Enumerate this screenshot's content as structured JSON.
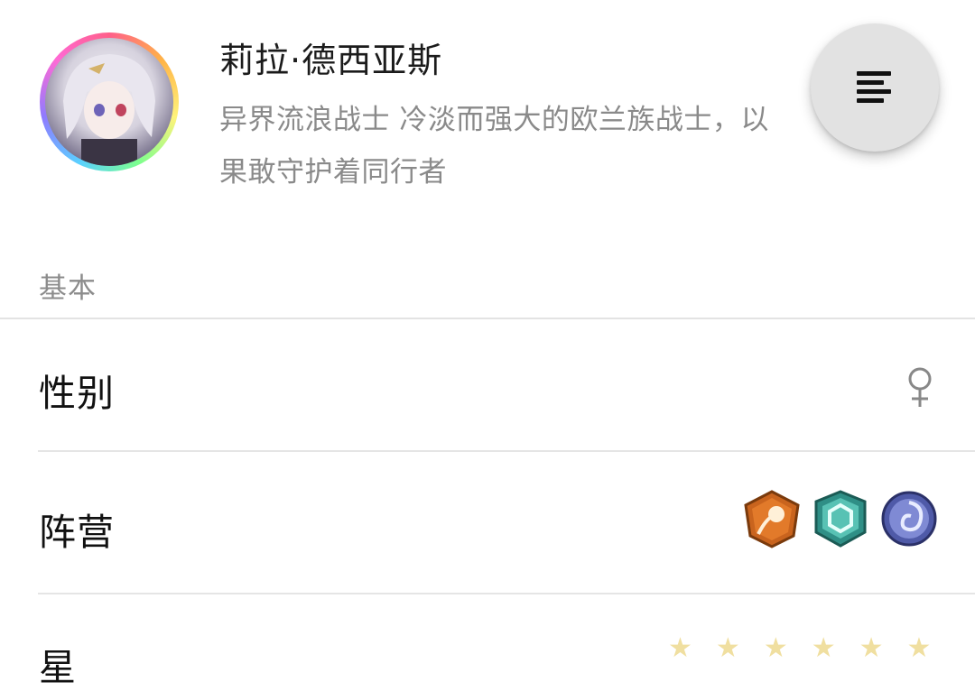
{
  "profile": {
    "name": "莉拉·德西亚斯",
    "description_lines": [
      "异界流浪战士 冷淡而强大的欧兰族战士，以",
      "果敢守护着同行者"
    ]
  },
  "fab": {
    "icon": "menu-lines-icon"
  },
  "section": {
    "title": "基本"
  },
  "rows": [
    {
      "label": "性别",
      "value_icon": "female-icon",
      "value_symbol": "♀"
    },
    {
      "label": "阵营",
      "value_icons": [
        "fire-faction-icon",
        "crystal-faction-icon",
        "vortex-faction-icon"
      ]
    },
    {
      "label": "星",
      "value_icons": [
        "star-icon",
        "star-icon",
        "star-icon",
        "star-icon",
        "star-icon",
        "star-icon"
      ]
    }
  ],
  "colors": {
    "accent_gray": "#8a8a8a",
    "fab_bg": "#e2e2e2",
    "faction_fire": "#c9641e",
    "faction_crystal": "#2f8f86",
    "faction_vortex": "#4f5aa8"
  }
}
